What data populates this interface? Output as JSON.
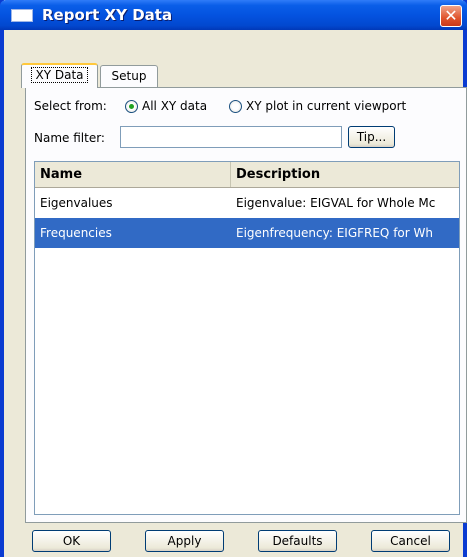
{
  "window": {
    "title": "Report XY Data",
    "close_glyph": "✕"
  },
  "tabs": [
    {
      "label": "XY Data"
    },
    {
      "label": "Setup"
    }
  ],
  "select_from": {
    "label": "Select from:",
    "options": [
      {
        "label": "All XY data",
        "selected": true
      },
      {
        "label": "XY plot in current viewport",
        "selected": false
      }
    ]
  },
  "name_filter": {
    "label": "Name filter:",
    "value": "",
    "tip_button": "Tip..."
  },
  "table": {
    "columns": [
      "Name",
      "Description"
    ],
    "rows": [
      {
        "name": "Eigenvalues",
        "description": "Eigenvalue: EIGVAL for Whole Mc",
        "selected": false
      },
      {
        "name": "Frequencies",
        "description": "Eigenfrequency: EIGFREQ for Wh",
        "selected": true
      }
    ]
  },
  "buttons": {
    "ok": "OK",
    "apply": "Apply",
    "defaults": "Defaults",
    "cancel": "Cancel"
  },
  "colors": {
    "title_bar": "#0453e0",
    "selection": "#316ac5",
    "close": "#e0542c"
  }
}
